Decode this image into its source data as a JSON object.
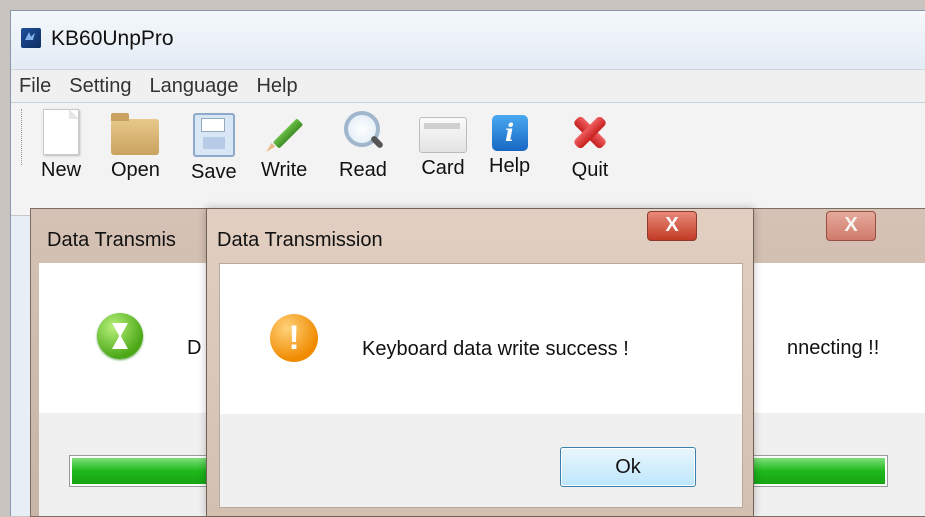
{
  "window": {
    "title": "KB60UnpPro"
  },
  "menu": [
    "File",
    "Setting",
    "Language",
    "Help"
  ],
  "toolbar": [
    "New",
    "Open",
    "Save",
    "Write",
    "Read",
    "Card",
    "Help",
    "Quit"
  ],
  "help_icon_glyph": "i",
  "close_glyph": "X",
  "back_dialog": {
    "title": "Data Transmis",
    "message_left": "D",
    "message_right": "nnecting !!",
    "progress": 1.0,
    "icon": "hourglass-icon"
  },
  "front_dialog": {
    "title": "Data Transmission",
    "message": "Keyboard data write success !",
    "ok_label": "Ok",
    "icon": "warning-icon",
    "icon_glyph": "!"
  },
  "colors": {
    "progress": "#1fb81c",
    "close": "#c23b24",
    "warning": "#f08a00"
  }
}
